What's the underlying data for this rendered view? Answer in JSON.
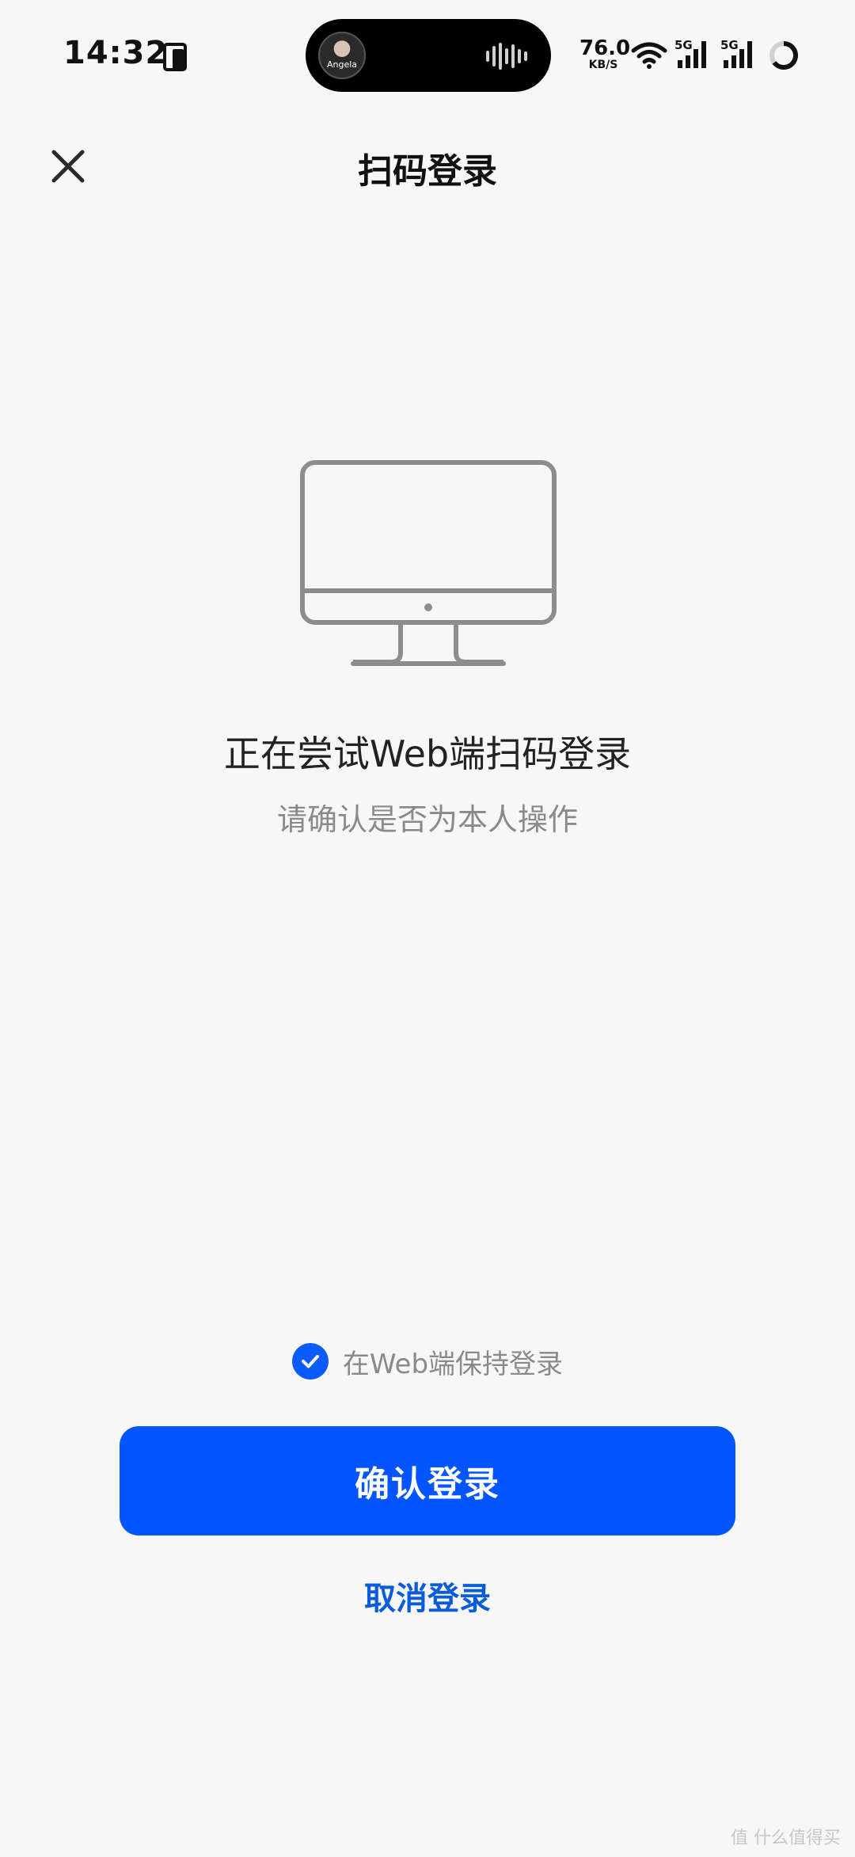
{
  "status_bar": {
    "time": "14:32",
    "island_avatar_label": "Angela",
    "net_speed_value": "76.0",
    "net_speed_unit": "KB/S",
    "sim1_label": "5G",
    "sim2_label": "5G"
  },
  "nav": {
    "title": "扫码登录"
  },
  "content": {
    "headline": "正在尝试Web端扫码登录",
    "subline": "请确认是否为本人操作"
  },
  "keep_login": {
    "label": "在Web端保持登录",
    "checked": true
  },
  "actions": {
    "confirm_label": "确认登录",
    "cancel_label": "取消登录"
  },
  "watermark": "值 什么值得买",
  "colors": {
    "primary": "#0356ff",
    "link": "#0a5cd8",
    "background": "#f7f7f8",
    "secondary_text": "#8a8a8a"
  }
}
